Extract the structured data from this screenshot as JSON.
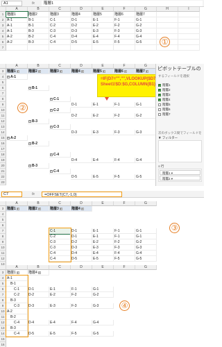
{
  "section1": {
    "name_box": "A1",
    "formula": "階層1",
    "circle": "①",
    "columns": [
      "A",
      "B",
      "C",
      "D",
      "E",
      "F",
      "G",
      "H",
      "I"
    ],
    "rows": [
      [
        "階層1",
        "階層2",
        "階層3",
        "階層4",
        "階層5",
        "階層6",
        "階層7"
      ],
      [
        "A-1",
        "B-1",
        "C-1",
        "D-1",
        "E-1",
        "F-1",
        "G-1"
      ],
      [
        "A-1",
        "B-1",
        "C-2",
        "D-2",
        "E-2",
        "F-2",
        "G-2"
      ],
      [
        "A-1",
        "B-3",
        "C-3",
        "D-3",
        "E-3",
        "F-3",
        "G-3"
      ],
      [
        "A-2",
        "B-2",
        "C-4",
        "D-4",
        "E-4",
        "F-4",
        "G-4"
      ],
      [
        "A-2",
        "B-3",
        "C-4",
        "D-5",
        "E-5",
        "F-5",
        "G-5"
      ]
    ]
  },
  "section2": {
    "circle": "②",
    "columns": [
      "A",
      "B",
      "C",
      "D",
      "E",
      "F",
      "G"
    ],
    "header_row": [
      "階層1",
      "階層2",
      "階層3",
      "階層4",
      "階層5",
      "階層6",
      "階層7"
    ],
    "tip_lines": [
      "=IF(D7=\"\",\"\",VLOOKUP($D7,",
      "Sheet1!$D:$G,COLUMN(B1),FALSE))"
    ],
    "row_numbers": [
      "3",
      "4",
      "5",
      "6",
      "7",
      "8",
      "9",
      "10",
      "11",
      "12",
      "13",
      "14",
      "15",
      "16",
      "17",
      "18",
      "19",
      "20",
      "21",
      "22",
      "23"
    ],
    "tree": [
      {
        "row": 1,
        "col": 0,
        "text": "A-1"
      },
      {
        "row": 3,
        "col": 1,
        "text": "B-1"
      },
      {
        "row": 5,
        "col": 2,
        "text": "C-1"
      },
      {
        "row": 6,
        "col": 3,
        "text": "D-1",
        "vals": [
          "E-1",
          "F-1",
          "G-1"
        ]
      },
      {
        "row": 7,
        "col": 2,
        "text": "C-2"
      },
      {
        "row": 8,
        "col": 3,
        "text": "D-2",
        "vals": [
          "E-2",
          "F-2",
          "G-2"
        ]
      },
      {
        "row": 9,
        "col": 1,
        "text": "B-3"
      },
      {
        "row": 10,
        "col": 2,
        "text": "C-3"
      },
      {
        "row": 11,
        "col": 3,
        "text": "D-3",
        "vals": [
          "E-3",
          "F-3",
          "G-3"
        ]
      },
      {
        "row": 12,
        "col": 0,
        "text": "A-2"
      },
      {
        "row": 13,
        "col": 1,
        "text": "B-2"
      },
      {
        "row": 15,
        "col": 2,
        "text": "C-4"
      },
      {
        "row": 16,
        "col": 3,
        "text": "D-4",
        "vals": [
          "E-4",
          "F-4",
          "G-4"
        ]
      },
      {
        "row": 17,
        "col": 1,
        "text": "B-3"
      },
      {
        "row": 18,
        "col": 2,
        "text": "C-4"
      },
      {
        "row": 19,
        "col": 3,
        "text": "D-5",
        "vals": [
          "E-5",
          "F-5",
          "G-5"
        ]
      }
    ],
    "panel": {
      "title": "ピボットテーブルの",
      "subtitle": "するフィールドを選択",
      "fields": [
        {
          "label": "階層1",
          "checked": true
        },
        {
          "label": "階層2",
          "checked": true
        },
        {
          "label": "階層3",
          "checked": true
        },
        {
          "label": "階層4",
          "checked": true
        },
        {
          "label": "階層5",
          "checked": false
        },
        {
          "label": "階層6",
          "checked": false
        },
        {
          "label": "階層7",
          "checked": false
        }
      ],
      "drag_hint": "次のボックス間でフィールドをド",
      "filter_label": "フィルター",
      "row_label": "行",
      "row_items": [
        "階層1",
        "階層2"
      ]
    }
  },
  "section3": {
    "name_box": "C7",
    "formula": "=OFFSET(C7,-1,0)",
    "circle": "③",
    "columns": [
      "A",
      "B",
      "C",
      "D",
      "E",
      "F",
      "G"
    ],
    "header_row": [
      "階層1",
      "階層2",
      "階層3",
      "階層4"
    ],
    "row_numbers": [
      "3",
      "4",
      "5",
      "6",
      "7",
      "8",
      "9",
      "10",
      "11",
      "12",
      "13"
    ],
    "rows": [
      [
        "C-1",
        "D-1",
        "E-1",
        "F-1",
        "G-1"
      ],
      [
        "C-2",
        "D-1",
        "E-1",
        "F-1",
        "G-1"
      ],
      [
        "C-3",
        "D-2",
        "E-2",
        "F-2",
        "G-2"
      ],
      [
        "C-3",
        "D-3",
        "E-3",
        "F-3",
        "G-3"
      ],
      [
        "C-4",
        "D-4",
        "E-4",
        "F-4",
        "G-4"
      ],
      [
        "C-4",
        "D-5",
        "E-5",
        "F-5",
        "G-5"
      ]
    ]
  },
  "section4": {
    "circle": "④",
    "columns": [
      "A",
      "B",
      "C",
      "D",
      "E",
      "F",
      "G"
    ],
    "header_row": [
      "階層1",
      "階層4"
    ],
    "row_numbers": [
      "3",
      "4",
      "5",
      "6",
      "7",
      "8",
      "9",
      "10",
      "11",
      "12",
      "13",
      "14",
      "15",
      "16"
    ],
    "items": [
      {
        "row": 1,
        "text": "A-1",
        "indent": 0
      },
      {
        "row": 2,
        "text": "B-1",
        "indent": 1
      },
      {
        "row": 3,
        "text": "C-1",
        "indent": 2,
        "vals": [
          "D-1",
          "E-1",
          "F-1",
          "G-1"
        ]
      },
      {
        "row": 4,
        "text": "C-2",
        "indent": 2,
        "vals": [
          "D-2",
          "E-2",
          "F-2",
          "G-2"
        ]
      },
      {
        "row": 5,
        "text": "B-3",
        "indent": 1
      },
      {
        "row": 6,
        "text": "C-3",
        "indent": 2,
        "vals": [
          "D-3",
          "E-3",
          "F-3",
          "G-3"
        ]
      },
      {
        "row": 7,
        "text": "A-2",
        "indent": 0
      },
      {
        "row": 8,
        "text": "B-2",
        "indent": 1
      },
      {
        "row": 9,
        "text": "C-4",
        "indent": 2,
        "vals": [
          "D-4",
          "E-4",
          "F-4",
          "G-4"
        ]
      },
      {
        "row": 10,
        "text": "B-3",
        "indent": 1
      },
      {
        "row": 11,
        "text": "C-4",
        "indent": 2,
        "vals": [
          "D-5",
          "E-5",
          "F-5",
          "G-5"
        ]
      }
    ]
  }
}
